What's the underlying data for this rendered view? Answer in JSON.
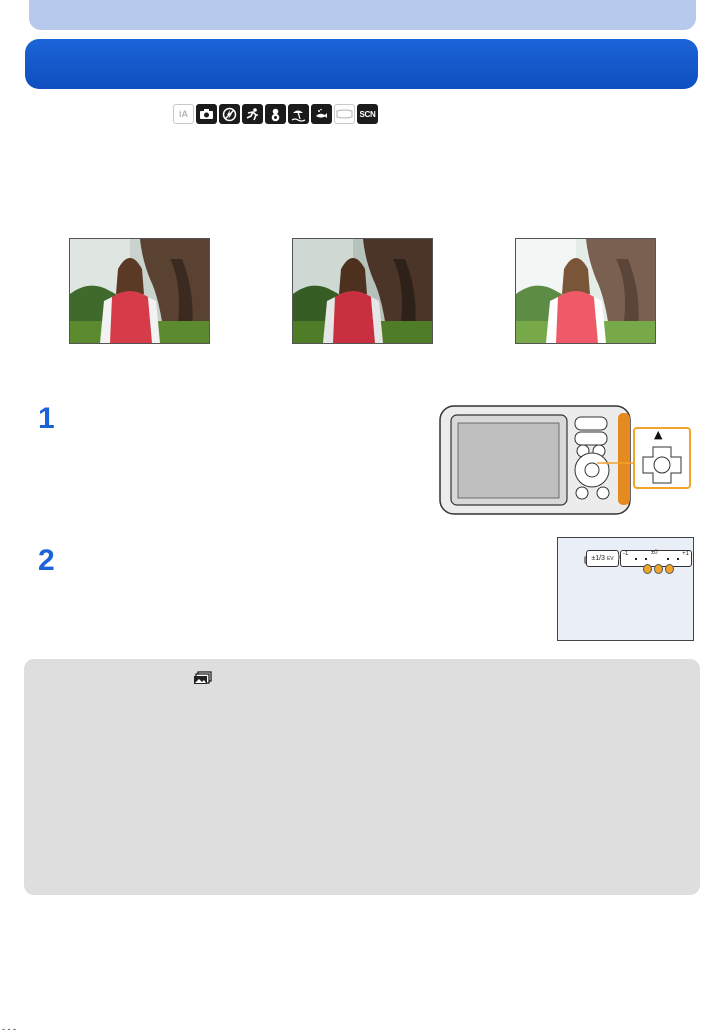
{
  "mode_icons": [
    "ia-mode-icon",
    "camera-mode-icon",
    "no-flash-icon",
    "sports-icon",
    "snow-icon",
    "beach-icon",
    "underwater-icon",
    "panorama-icon",
    "scn-mode-icon"
  ],
  "mode_icons_text": {
    "scn": "SCN",
    "ia": "iA"
  },
  "step_numbers": {
    "one": "1",
    "two": "2"
  },
  "camera_arrow_glyph": "▲",
  "exposure_panel": {
    "value": "±1/3",
    "unit": "EV",
    "scale_min": "-1",
    "scale_mid": "±0",
    "scale_max": "+1"
  },
  "footer_mark": "- - -",
  "colors": {
    "title_blue": "#1b64d8",
    "step_blue": "#1b63d6",
    "highlight_orange": "#f2a32a",
    "note_gray": "#dedede"
  }
}
